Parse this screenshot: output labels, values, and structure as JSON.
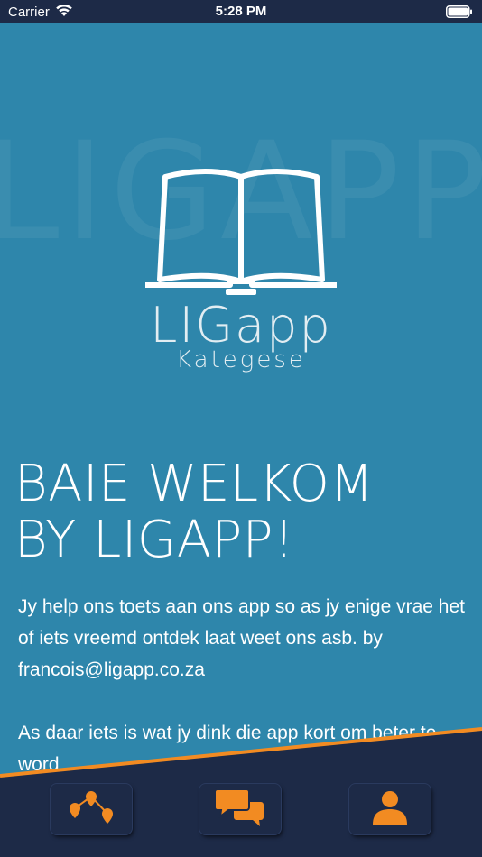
{
  "status_bar": {
    "carrier": "Carrier",
    "time": "5:28 PM"
  },
  "logo": {
    "watermark": "LIGAPP",
    "wordmark": "LIGapp",
    "subtitle": "Kategese"
  },
  "welcome": {
    "line1": "BAIE WELKOM",
    "line2": "BY LIGAPP!"
  },
  "body": {
    "paragraph1": "Jy help ons toets aan ons app so as jy enige vrae het of iets vreemd ontdek laat weet ons asb. by francois@ligapp.co.za",
    "paragraph2": "As daar iets is wat jy dink die app kort om beter te word"
  },
  "tabbar": {
    "items": [
      {
        "icon": "map-pins-icon"
      },
      {
        "icon": "chat-bubbles-icon"
      },
      {
        "icon": "user-icon"
      }
    ]
  },
  "colors": {
    "background": "#2e86ab",
    "navy": "#1d2a47",
    "accent_orange": "#f28b22"
  }
}
